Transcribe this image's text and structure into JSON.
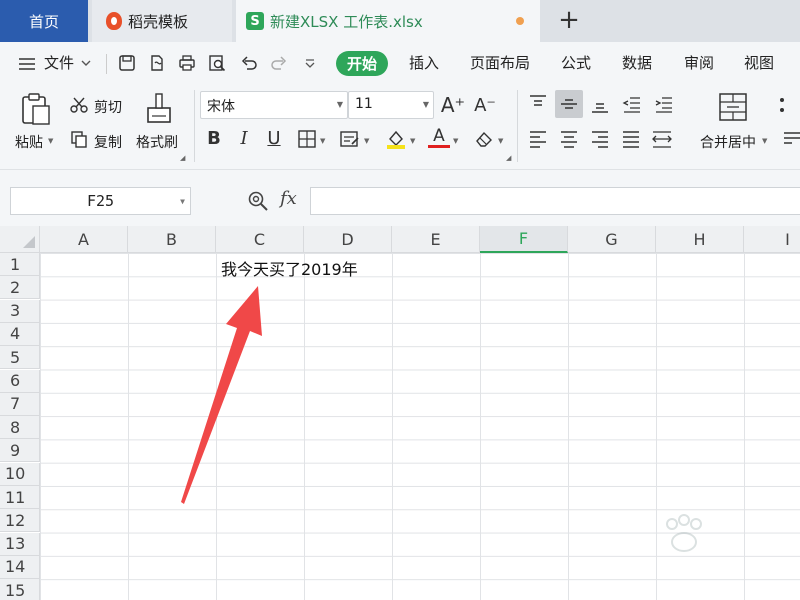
{
  "tabs": {
    "home": "首页",
    "daoke": "稻壳模板",
    "doc": "新建XLSX 工作表.xlsx",
    "doc_icon": "S",
    "new_tab": "+"
  },
  "menu": {
    "file": "文件",
    "start": "开始",
    "items": [
      "插入",
      "页面布局",
      "公式",
      "数据",
      "审阅",
      "视图"
    ]
  },
  "ribbon": {
    "paste": "粘贴",
    "cut": "剪切",
    "copy": "复制",
    "format_painter": "格式刷",
    "font_name": "宋体",
    "font_size": "11",
    "bold": "B",
    "italic": "I",
    "underline": "U",
    "font_color_letter": "A",
    "grow_font": "A⁺",
    "shrink_font": "A⁻",
    "merge_center": "合并居中",
    "accent": "#2ea65a"
  },
  "formula_bar": {
    "cell_ref": "F25",
    "fx": "fx",
    "value": ""
  },
  "sheet": {
    "columns": [
      "A",
      "B",
      "C",
      "D",
      "E",
      "F",
      "G",
      "H",
      "I"
    ],
    "selected_column": "F",
    "rows": [
      "1",
      "2",
      "3",
      "4",
      "5",
      "6",
      "7",
      "8",
      "9",
      "10",
      "11",
      "12",
      "13",
      "14",
      "15"
    ],
    "cell_C1": "我今天买了2019年"
  },
  "annotation": {
    "arrow_color": "#f04848"
  }
}
